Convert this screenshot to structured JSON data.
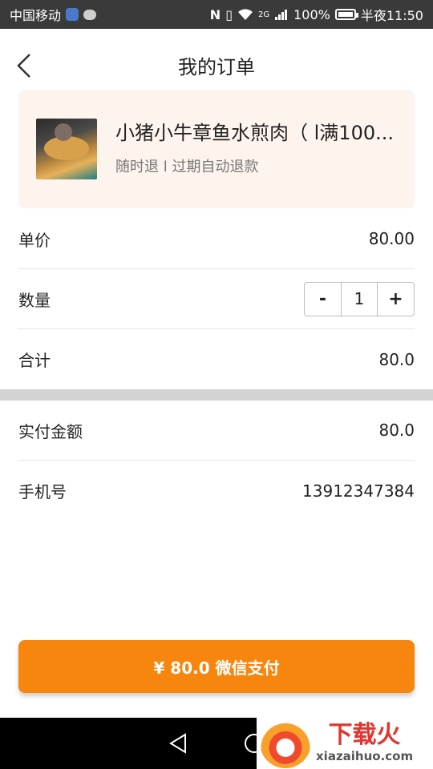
{
  "status_bar": {
    "carrier": "中国移动",
    "network": "2G",
    "battery": "100%",
    "battery_level": 1.0,
    "time": "半夜11:50"
  },
  "header": {
    "title": "我的订单"
  },
  "product": {
    "name": "小猪小牛章鱼水煎肉（ l满100...",
    "subtitle": "随时退 l 过期自动退款"
  },
  "order": {
    "unit_price_label": "单价",
    "unit_price": "80.00",
    "quantity_label": "数量",
    "quantity": "1",
    "decrement_label": "-",
    "increment_label": "+",
    "total_label": "合计",
    "total": "80.0"
  },
  "payment": {
    "amount_label": "实付金额",
    "amount": "80.0",
    "phone_label": "手机号",
    "phone": "13912347384"
  },
  "pay_button": {
    "label": "¥ 80.0 微信支付"
  },
  "watermark": {
    "name": "下载火",
    "url": "xiazaihuo.com"
  },
  "colors": {
    "accent": "#f7860f",
    "product_bg": "#fdf4ee",
    "status_bar": "#3a3a3a",
    "separator": "#d3d3d3"
  }
}
